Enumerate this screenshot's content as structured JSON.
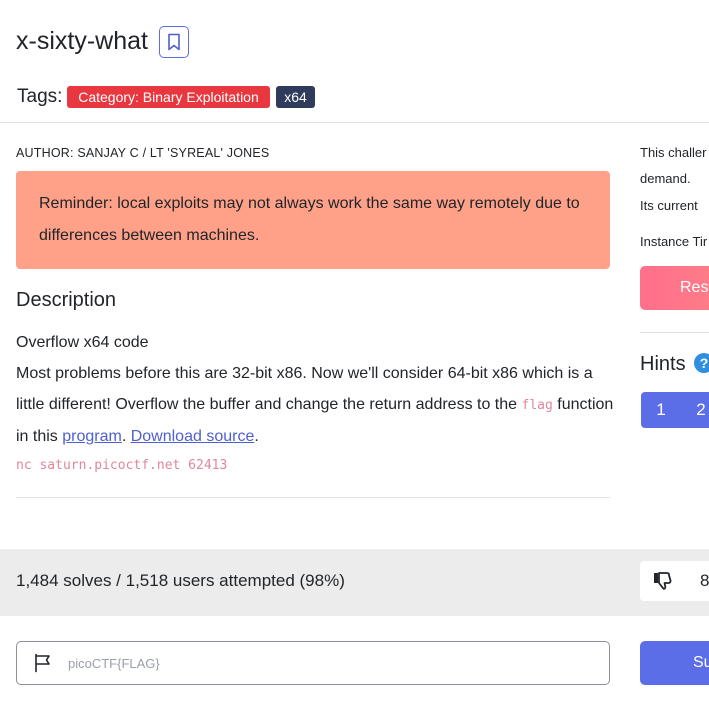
{
  "challenge": {
    "title": "x-sixty-what",
    "tags_label": "Tags:",
    "tags": [
      "Category: Binary Exploitation",
      "x64"
    ],
    "author": "AUTHOR: SANJAY C / LT 'SYREAL' JONES",
    "reminder": "Reminder: local exploits may not always work the same way remotely due to differences between machines.",
    "description_heading": "Description",
    "description": {
      "line1": "Overflow x64 code",
      "line2_pre": "Most problems before this are 32-bit x86. Now we'll consider 64-bit x86 which is a little different! Overflow the buffer and change the return address to the ",
      "flag_code": "flag",
      "line2_mid": " function in this ",
      "program_link": "program",
      "sep": ". ",
      "download_link": "Download source",
      "end": ".",
      "nc_command": "nc saturn.picoctf.net 62413"
    }
  },
  "sidebar": {
    "instance_text_1": "This challer",
    "instance_text_2": "demand.",
    "instance_text_3": "Its current",
    "instance_time": "Instance Tir",
    "restart_label": "Rest",
    "hints_heading": "Hints",
    "help_icon_glyph": "?",
    "hint_buttons": [
      "1",
      "2"
    ]
  },
  "stats": {
    "solves_text": "1,484 solves / 1,518 users attempted (98%)",
    "vote_count": "8"
  },
  "flag_form": {
    "placeholder": "picoCTF{FLAG}",
    "submit_label": "Su"
  },
  "colors": {
    "tag_category": "#e8373f",
    "tag_x64": "#2f3b5c",
    "reminder_bg": "#ffa188",
    "primary": "#5b6ee8",
    "restart": "#ff7088"
  },
  "icons": [
    "bookmark-icon",
    "help-icon",
    "thumbs-down-icon",
    "flag-icon"
  ]
}
